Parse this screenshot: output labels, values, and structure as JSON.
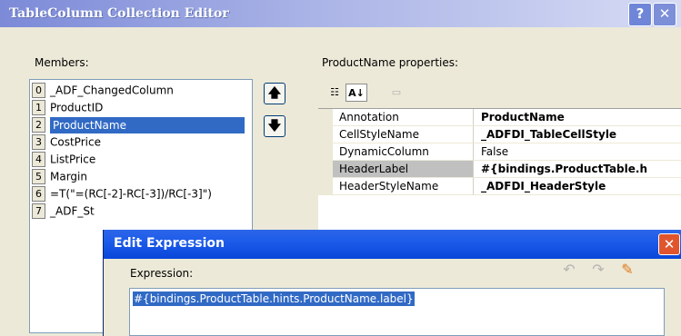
{
  "window": {
    "title": "TableColumn Collection Editor",
    "help_label": "?",
    "close_label": "✕"
  },
  "members": {
    "label": "Members:",
    "items": [
      {
        "index": "0",
        "label": "_ADF_ChangedColumn"
      },
      {
        "index": "1",
        "label": "ProductID"
      },
      {
        "index": "2",
        "label": "ProductName"
      },
      {
        "index": "3",
        "label": "CostPrice"
      },
      {
        "index": "4",
        "label": "ListPrice"
      },
      {
        "index": "5",
        "label": "Margin"
      },
      {
        "index": "6",
        "label": "=T(\"=(RC[-2]-RC[-3])/RC[-3]\")"
      },
      {
        "index": "7",
        "label": "_ADF_St"
      }
    ],
    "selected_index": 2,
    "move_up_icon": "up-arrow-icon",
    "move_down_icon": "down-arrow-icon"
  },
  "properties": {
    "label": "ProductName properties:",
    "toolbar": {
      "categorized_icon": "categorized-icon",
      "alphabetical_icon": "sort-az-icon",
      "property_pages_icon": "property-pages-icon"
    },
    "rows": [
      {
        "name": "Annotation",
        "value": "ProductName",
        "bold": true
      },
      {
        "name": "CellStyleName",
        "value": "_ADFDI_TableCellStyle",
        "bold": true
      },
      {
        "name": "DynamicColumn",
        "value": "False",
        "bold": false
      },
      {
        "name": "HeaderLabel",
        "value": "#{bindings.ProductTable.h",
        "bold": true
      },
      {
        "name": "HeaderStyleName",
        "value": "_ADFDI_HeaderStyle",
        "bold": true
      }
    ],
    "selected_row": 3
  },
  "dialog": {
    "title": "Edit Expression",
    "close_label": "✕",
    "expression_label": "Expression:",
    "expression_value": "#{bindings.ProductTable.hints.ProductName.label}",
    "undo_icon": "undo-icon",
    "redo_icon": "redo-icon",
    "clear_icon": "eraser-icon"
  },
  "colors": {
    "selection": "#316AC5",
    "dialog_title": "#0846D8",
    "dialog_close": "#E0552E",
    "inactive_title": "#7C8AD8"
  }
}
